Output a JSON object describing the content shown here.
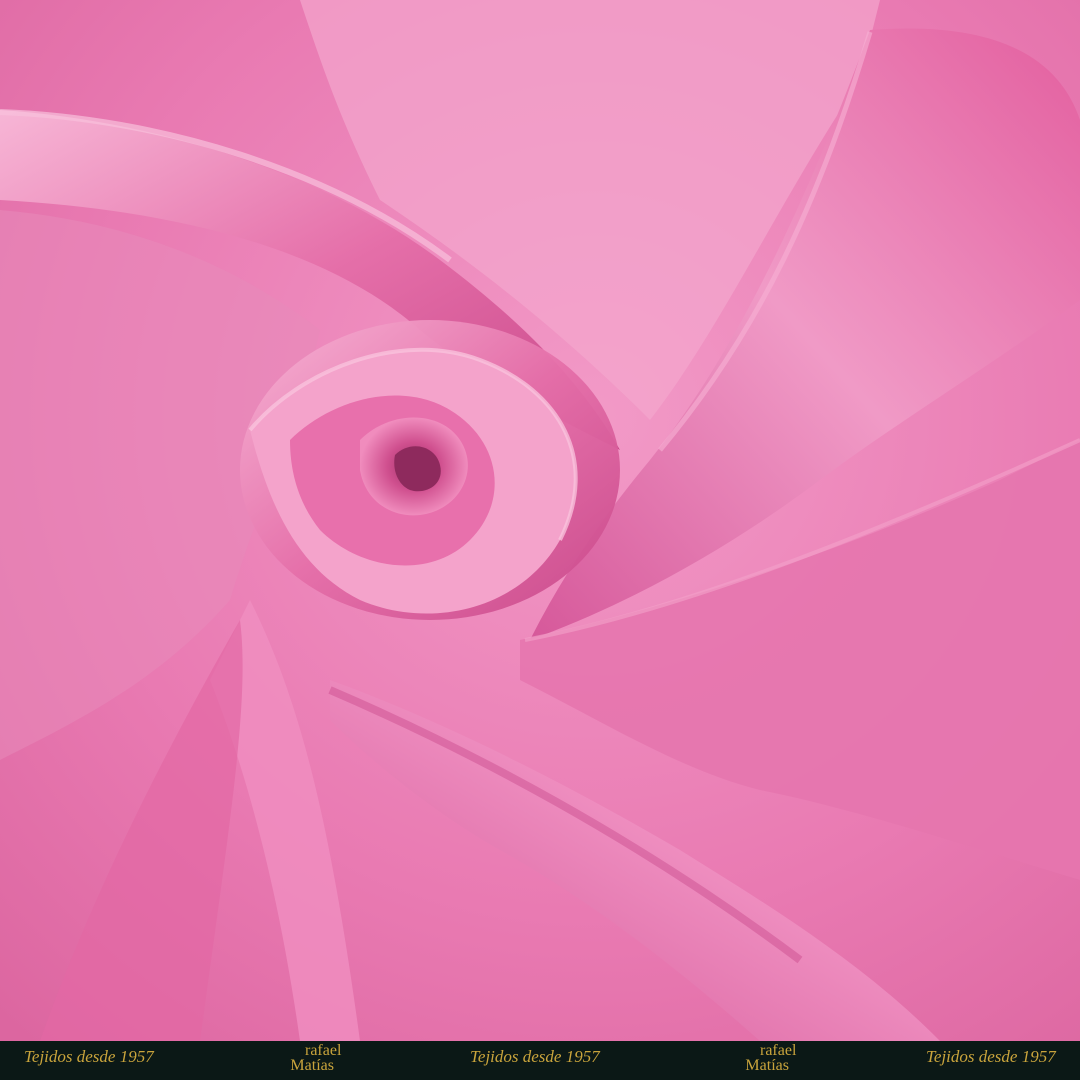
{
  "image": {
    "subject": "pink-silk-chiffon-swirl",
    "colors": {
      "base": "#e56fa9",
      "light": "#f29ac7",
      "highlight": "#f7b6d6",
      "mid": "#e35f9f",
      "deep": "#c84789",
      "shadow": "#9c2f66"
    }
  },
  "footer": {
    "tagline_left": "Tejidos desde 1957",
    "tagline_center": "Tejidos desde 1957",
    "tagline_right": "Tejidos desde 1957",
    "brand_line1": "rafael",
    "brand_line2": "Matías",
    "colors": {
      "bar": "#0b1816",
      "text": "#c9a43c"
    }
  }
}
